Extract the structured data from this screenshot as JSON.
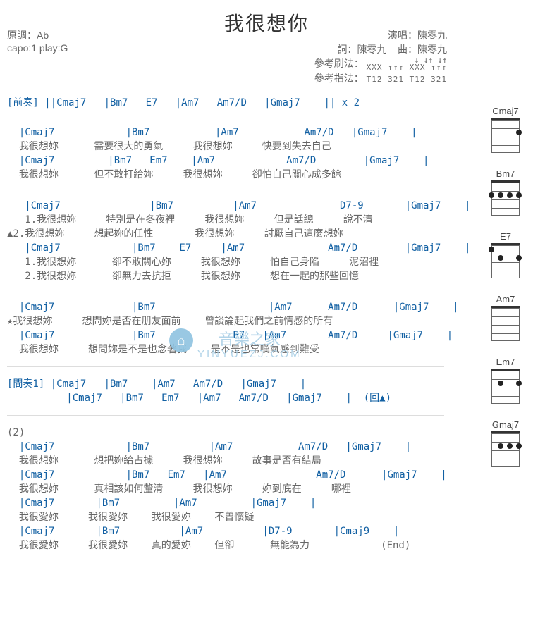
{
  "title": "我很想你",
  "meta": {
    "key_label": "原調：",
    "key_value": "Ab",
    "capo": "capo:1 play:G",
    "singer_label": "演唱：",
    "singer": "陳零九",
    "lyrics_label": "詞：",
    "lyrics_by": "陳零九",
    "music_label": "曲：",
    "music_by": "陳零九",
    "strum_label": "參考刷法：",
    "strum_top": "↓  ↓↑  ↓↑",
    "strum_bottom": "XXX ↑↑↑ XXX ↑↑↑",
    "finger_label": "參考指法：",
    "finger_pattern": "T12 321 T12 321"
  },
  "intro": {
    "label": "[前奏]",
    "chords": "||Cmaj7   |Bm7   E7   |Am7   Am7/D   |Gmaj7    || x 2"
  },
  "verse_a": {
    "l1c": "  |Cmaj7            |Bm7           |Am7           Am7/D   |Gmaj7    |",
    "l1t": "  我很想妳      需要很大的勇氣     我很想妳     快要到失去自己",
    "l2c": "  |Cmaj7         |Bm7   Em7    |Am7            Am7/D        |Gmaj7    |",
    "l2t": "  我很想妳      但不敢打給妳     我很想妳     卻怕自己關心成多餘"
  },
  "verse_b": {
    "b1c": "   |Cmaj7               |Bm7          |Am7              D7-9       |Gmaj7    |",
    "b1a": "   1.我很想妳     特別是在冬夜裡     我很想妳     但是話總     說不清",
    "b1b": "▲2.我很想妳     想起妳的任性       我很想妳     討厭自己這麼想妳",
    "b2c": "   |Cmaj7            |Bm7    E7     |Am7              Am7/D        |Gmaj7    |",
    "b2a": "   1.我很想妳      卻不敢關心妳     我很想妳     怕自己身陷     泥沼裡",
    "b2b": "   2.我很想妳      卻無力去抗拒     我很想妳     想在一起的那些回憶"
  },
  "chorus": {
    "c1c": "  |Cmaj7             |Bm7                   |Am7      Am7/D      |Gmaj7    |",
    "c1t": "★我很想妳     想問妳是否在朋友面前    曾談論起我們之前情感的所有",
    "c2c": "  |Cmaj7             |Bm7             E7   |Am7       Am7/D     |Gmaj7    |",
    "c2t": "  我很想妳     想問妳是不是也念著我    是不是也常嘆氣感到難受"
  },
  "interlude": {
    "label": "[間奏1]",
    "r1": "|Cmaj7   |Bm7    |Am7   Am7/D   |Gmaj7    |",
    "r2": "|Cmaj7   |Bm7   Em7   |Am7   Am7/D   |Gmaj7    |  (回▲)"
  },
  "outro": {
    "tag": "(2)",
    "o1c": "  |Cmaj7            |Bm7          |Am7           Am7/D   |Gmaj7    |",
    "o1t": "  我很想妳      想把妳給占據     我很想妳     故事是否有結局",
    "o2c": "  |Cmaj7            |Bm7   Em7   |Am7               Am7/D      |Gmaj7    |",
    "o2t": "  我很想妳      真相該如何釐清     我很想妳     妳到底在     哪裡",
    "o3c": "  |Cmaj7       |Bm7         |Am7         |Gmaj7    |",
    "o3t": "  我很愛妳     我很愛妳    我很愛妳    不曾懷疑",
    "o4c": "  |Cmaj7       |Bm7          |Am7          |D7-9       |Cmaj9    |",
    "o4t": "  我很愛妳     我很愛妳    真的愛妳    但卻      無能為力            (End)"
  },
  "chord_diagrams": [
    "Cmaj7",
    "Bm7",
    "E7",
    "Am7",
    "Em7",
    "Gmaj7"
  ],
  "watermark": {
    "main": "音樂之家",
    "sub": "YINYUEZJ.COM",
    "icon": "⌂"
  }
}
